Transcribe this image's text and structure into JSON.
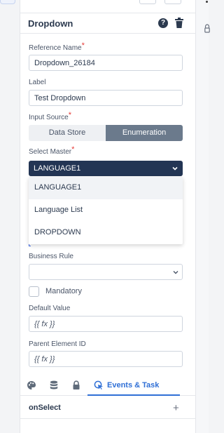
{
  "panel": {
    "title": "Dropdown"
  },
  "fields": {
    "reference_name_label": "Reference Name",
    "reference_name_value": "Dropdown_26184",
    "label_label": "Label",
    "label_value": "Test Dropdown",
    "input_source_label": "Input Source",
    "select_master_label": "Select Master",
    "select_master_value": "LANGUAGE1",
    "business_rule_label": "Business Rule",
    "business_rule_value": "",
    "mandatory_label": "Mandatory",
    "default_value_label": "Default Value",
    "default_value_value": "{{ fx }}",
    "parent_element_label": "Parent Element ID",
    "parent_element_value": "{{ fx }}"
  },
  "required_marker": "*",
  "input_source": {
    "options": [
      "Data Store",
      "Enumeration"
    ],
    "selected": "Enumeration"
  },
  "dropdown_menu": {
    "options": [
      "LANGUAGE1",
      "Language List",
      "DROPDOWN"
    ],
    "selected_index": 0
  },
  "tabs": {
    "icons": [
      "palette-icon",
      "database-icon",
      "lock-icon"
    ],
    "active_label": "Events & Task",
    "active_icon": "cursor-click-icon"
  },
  "events": {
    "row_label": "onSelect"
  },
  "colors": {
    "accent": "#2f6fd6",
    "select_bg": "#233554",
    "segment_active": "#6b7a8c",
    "required": "#e53935"
  }
}
